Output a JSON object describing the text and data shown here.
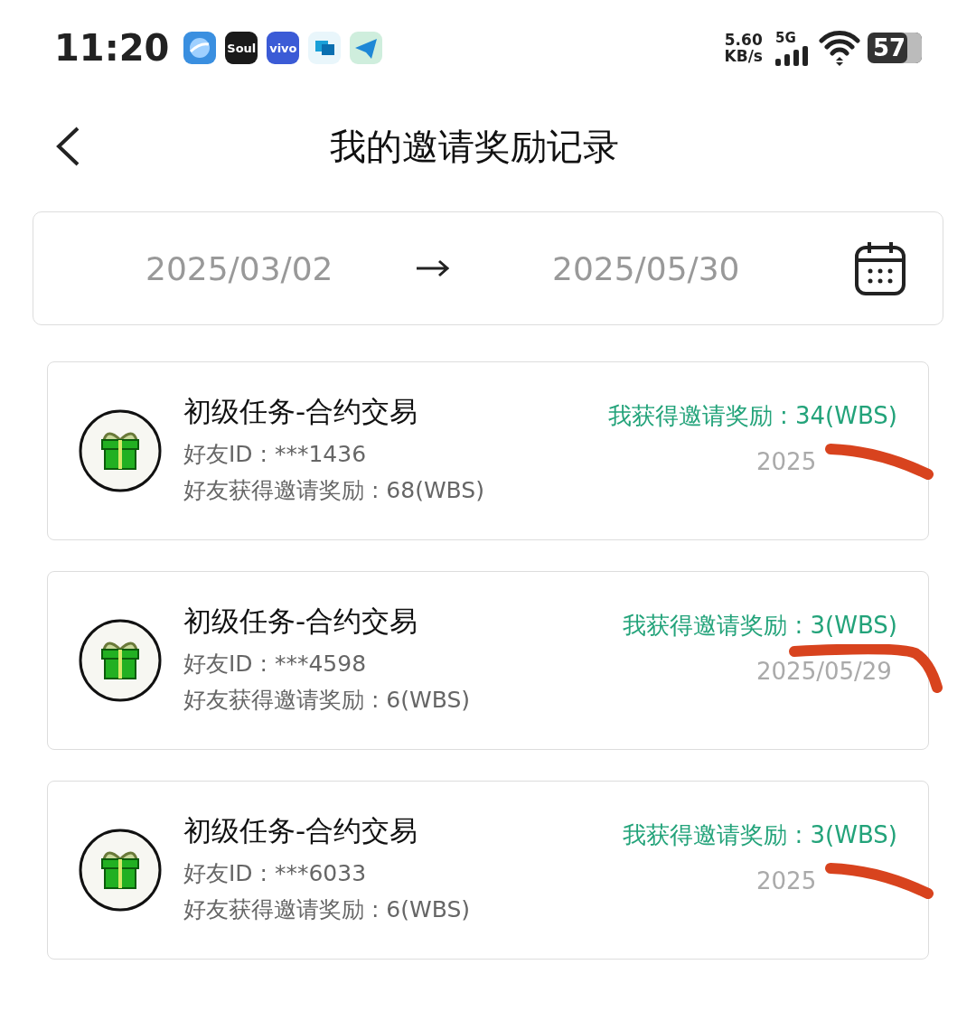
{
  "status_bar": {
    "time": "11:20",
    "app_icons": [
      {
        "kind": "orb"
      },
      {
        "kind": "text",
        "label": "Soul",
        "color": "#1a1a1a"
      },
      {
        "kind": "text",
        "label": "vivo",
        "color": "#3b5bd6"
      },
      {
        "kind": "chat"
      },
      {
        "kind": "plane"
      }
    ],
    "net_speed": "5.60",
    "net_unit": "KB/s",
    "network": "5G",
    "battery": "57"
  },
  "header": {
    "title": "我的邀请奖励记录"
  },
  "date_range": {
    "start": "2025/03/02",
    "end": "2025/05/30"
  },
  "records": [
    {
      "title": "初级任务-合约交易",
      "friend_id": "好友ID : ***1436",
      "friend_reward": "好友获得邀请奖励 : 68(WBS)",
      "my_reward": "我获得邀请奖励 : 34(WBS)",
      "date": "2025",
      "scribble": {
        "kind": "line"
      }
    },
    {
      "title": "初级任务-合约交易",
      "friend_id": "好友ID : ***4598",
      "friend_reward": "好友获得邀请奖励 : 6(WBS)",
      "my_reward": "我获得邀请奖励 : 3(WBS)",
      "date": "2025/05/29",
      "scribble": {
        "kind": "hook"
      }
    },
    {
      "title": "初级任务-合约交易",
      "friend_id": "好友ID : ***6033",
      "friend_reward": "好友获得邀请奖励 : 6(WBS)",
      "my_reward": "我获得邀请奖励 : 3(WBS)",
      "date": "2025",
      "scribble": {
        "kind": "line"
      }
    }
  ]
}
